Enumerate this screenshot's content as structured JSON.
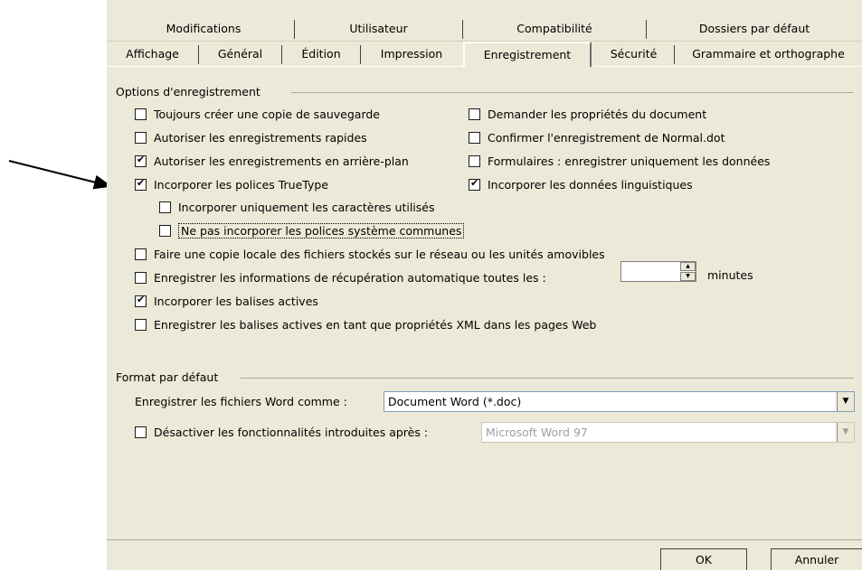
{
  "tabs_row1": [
    "Modifications",
    "Utilisateur",
    "Compatibilité",
    "Dossiers par défaut"
  ],
  "tabs_row2": [
    "Affichage",
    "Général",
    "Édition",
    "Impression",
    "Enregistrement",
    "Sécurité",
    "Grammaire et orthographe"
  ],
  "active_tab": "Enregistrement",
  "save_options": {
    "legend": "Options d'enregistrement",
    "left": [
      {
        "label": "Toujours créer une copie de sauvegarde",
        "checked": false
      },
      {
        "label": "Autoriser les enregistrements rapides",
        "checked": false
      },
      {
        "label": "Autoriser les enregistrements en arrière-plan",
        "checked": true
      },
      {
        "label": "Incorporer les polices TrueType",
        "checked": true
      },
      {
        "label": "Incorporer uniquement les caractères utilisés",
        "checked": false
      },
      {
        "label": "Ne pas incorporer les polices système communes",
        "checked": false
      }
    ],
    "right": [
      {
        "label": "Demander les propriétés du document",
        "checked": false
      },
      {
        "label": "Confirmer l'enregistrement de Normal.dot",
        "checked": false
      },
      {
        "label": "Formulaires : enregistrer uniquement les données",
        "checked": false
      },
      {
        "label": "Incorporer les données linguistiques",
        "checked": true
      }
    ],
    "full": [
      {
        "label": "Faire une copie locale des fichiers stockés sur le réseau ou les unités amovibles",
        "checked": false
      },
      {
        "label": "Enregistrer les informations de récupération automatique toutes les :",
        "checked": false
      },
      {
        "label": "Incorporer les balises actives",
        "checked": true
      },
      {
        "label": "Enregistrer les balises actives en tant que propriétés XML dans les pages Web",
        "checked": false
      }
    ],
    "minutes_value": "",
    "minutes_label": "minutes"
  },
  "default_format": {
    "legend": "Format par défaut",
    "save_as_label": "Enregistrer les fichiers Word comme :",
    "save_as_value": "Document Word (*.doc)",
    "disable_label": "Désactiver les fonctionnalités introduites après :",
    "disable_checked": false,
    "disable_value": "Microsoft Word 97"
  },
  "buttons": {
    "ok": "OK",
    "cancel": "Annuler"
  },
  "annotation": {
    "arrow_color": "#000000"
  }
}
